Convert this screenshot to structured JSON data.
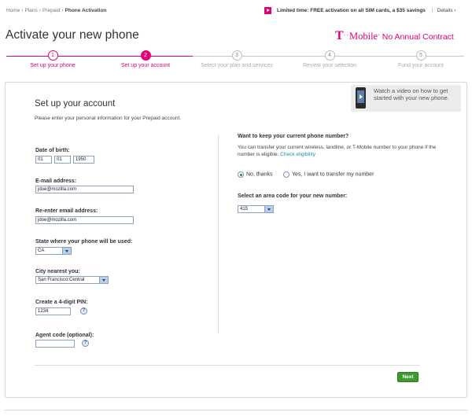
{
  "breadcrumb": {
    "home": "Home",
    "plans": "Plans",
    "prepaid": "Prepaid",
    "current": "Phone Activation",
    "separator": "›"
  },
  "promo": {
    "text": "Limited time: FREE activation on all SIM cards, a $35 savings",
    "divider": "|",
    "details_label": "Details ›",
    "icon": "play-icon",
    "icon_color": "#e20074"
  },
  "header": {
    "title": "Activate your new phone"
  },
  "brand": {
    "t_mark": "T",
    "dots": "··",
    "mobile": "Mobile",
    "dot_after": "·",
    "tagline": "No Annual Contract",
    "color": "#e20074"
  },
  "steps": [
    {
      "number": "1",
      "label": "Set up your phone",
      "state": "done"
    },
    {
      "number": "2",
      "label": "Set up your account",
      "state": "current"
    },
    {
      "number": "3",
      "label": "Select your plan and services",
      "state": "upcoming"
    },
    {
      "number": "4",
      "label": "Review your selection",
      "state": "upcoming"
    },
    {
      "number": "5",
      "label": "Fund your account",
      "state": "upcoming"
    }
  ],
  "video": {
    "text_pre": "Watch a video",
    "text_post": " on how to get started with your new phone.",
    "icon": "phone-video-icon"
  },
  "form": {
    "title": "Set up your account",
    "description": "Please enter your personal information for your Prepaid account.",
    "dob_label": "Date of birth:",
    "dob_month": "01",
    "dob_day": "01",
    "dob_year": "1950",
    "email_label": "E-mail address:",
    "email_value": "jdoe@mozilla.com",
    "reemail_label": "Re-enter email address:",
    "reemail_value": "jdoe@mozilla.com",
    "state_label": "State where your phone will be used:",
    "state_value": "CA",
    "city_label": "City nearest you:",
    "city_value": "San Francisco:Central",
    "pin_label": "Create a 4-digit PIN:",
    "pin_value": "1234",
    "agent_label": "Agent code (optional):",
    "agent_value": "",
    "help_symbol": "?"
  },
  "number": {
    "keep_heading": "Want to keep your current phone number?",
    "keep_desc": "You can transfer your current wireless, landline, or T-Mobile number to your phone if the number is eligible.",
    "check_link": "Check eligibility",
    "radio_no": "No, thanks",
    "radio_yes": "Yes, I want to transfer my number",
    "selected": "no",
    "area_heading": "Select an area code for your new number:",
    "area_value": "415"
  },
  "actions": {
    "next_label": "Next",
    "next_color": "#3e9a2e"
  }
}
